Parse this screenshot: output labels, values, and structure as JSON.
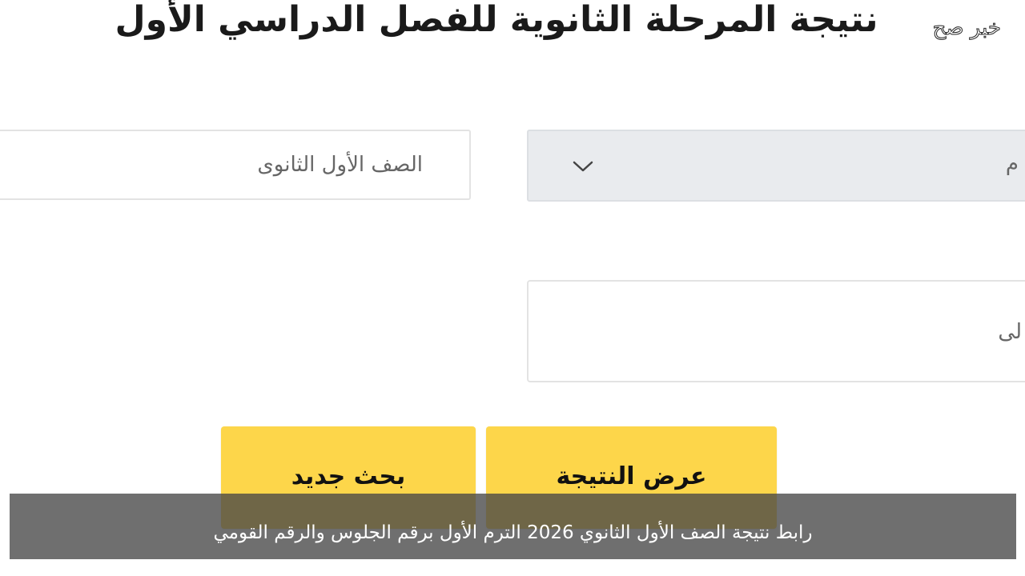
{
  "header": {
    "title": "نتيجة المرحلة الثانوية للفصل الدراسي الأول",
    "watermark": "خبر صح"
  },
  "form": {
    "grade_value": "الصف الأول الثانوى",
    "term_select_value": "م",
    "seat_input_value": "لى"
  },
  "buttons": {
    "new_search_label": "بحث جديد",
    "show_result_label": "عرض النتيجة"
  },
  "caption": {
    "text": "رابط نتيجة الصف الأول الثانوي 2026 الترم الأول برقم الجلوس والرقم القومي"
  },
  "colors": {
    "button_bg": "#fdd64a",
    "select_bg": "#e9ebee",
    "caption_bg": "#464646"
  },
  "icons": {
    "dropdown": "chevron-down-icon"
  }
}
